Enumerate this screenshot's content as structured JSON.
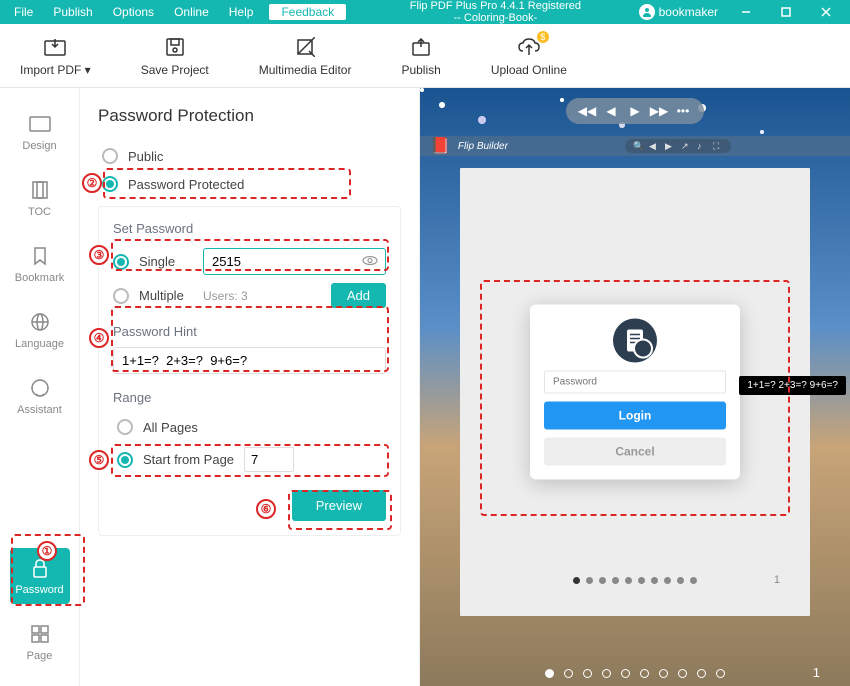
{
  "titlebar": {
    "menus": [
      "File",
      "Publish",
      "Options",
      "Online",
      "Help"
    ],
    "feedback": "Feedback",
    "title": "Flip PDF Plus Pro 4.4.1 Registered\n-- Coloring-Book-",
    "user": "bookmaker"
  },
  "toolbar": {
    "import": "Import PDF ▾",
    "save": "Save Project",
    "multimedia": "Multimedia Editor",
    "publish": "Publish",
    "upload": "Upload Online"
  },
  "sidebar": {
    "design": "Design",
    "toc": "TOC",
    "bookmark": "Bookmark",
    "language": "Language",
    "assistant": "Assistant",
    "password": "Password",
    "page": "Page"
  },
  "panel": {
    "title": "Password Protection",
    "public": "Public",
    "protected": "Password Protected",
    "set_password": "Set Password",
    "single": "Single",
    "single_value": "2515",
    "multiple": "Multiple",
    "users_count": "Users: 3",
    "add": "Add",
    "hint_label": "Password Hint",
    "hint_value": "1+1=?  2+3=?  9+6=?",
    "range": "Range",
    "all_pages": "All Pages",
    "start_from": "Start from Page",
    "start_value": "7",
    "preview": "Preview"
  },
  "preview": {
    "logo": "Flip Builder",
    "password_placeholder": "Password",
    "login": "Login",
    "cancel": "Cancel",
    "tooltip": "1+1=?  2+3=?  9+6=?",
    "page_num": "1"
  },
  "callouts": [
    "①",
    "②",
    "③",
    "④",
    "⑤",
    "⑥"
  ]
}
